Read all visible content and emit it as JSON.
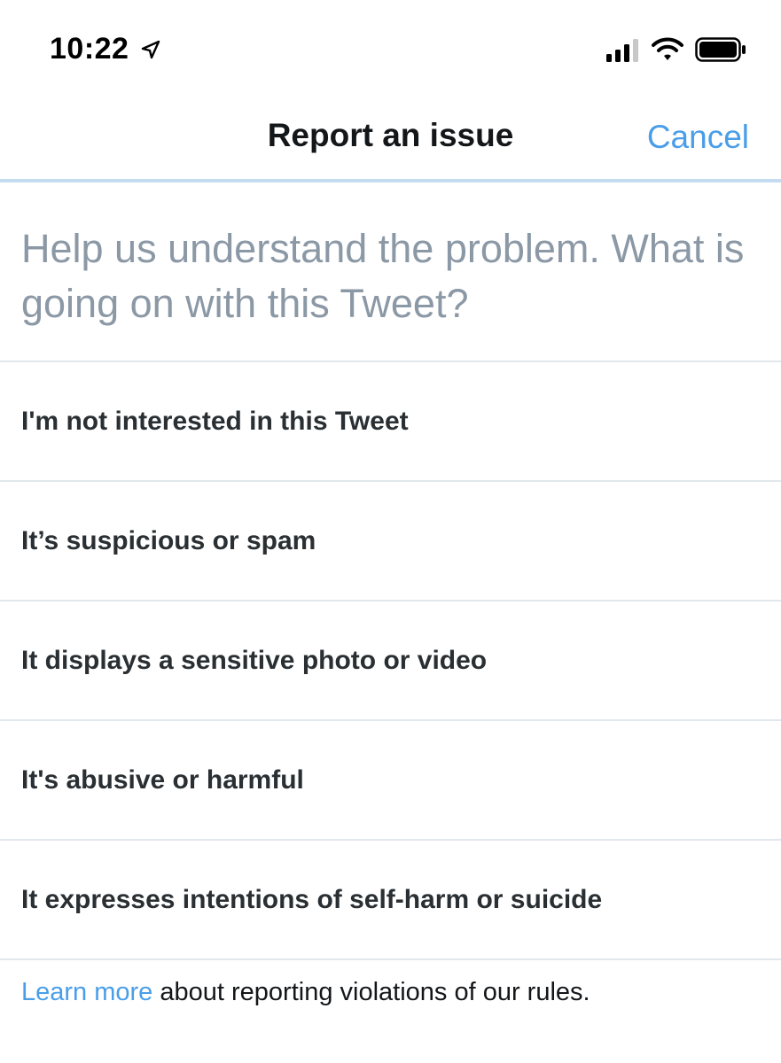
{
  "status_bar": {
    "time": "10:22",
    "icons": [
      "location-arrow-icon",
      "cellular-signal-icon",
      "wifi-icon",
      "battery-icon"
    ]
  },
  "header": {
    "title": "Report an issue",
    "cancel_label": "Cancel"
  },
  "prompt": "Help us understand the problem. What is going on with this Tweet?",
  "options": [
    "I'm not interested in this Tweet",
    "It’s suspicious or spam",
    "It displays a sensitive photo or video",
    "It's abusive or harmful",
    "It expresses intentions of self-harm or suicide"
  ],
  "footer": {
    "link_label": "Learn more",
    "text": " about reporting violations of our rules."
  },
  "colors": {
    "accent": "#4a9ee8",
    "divider": "#e1e8ed",
    "prompt_text": "#8b98a5"
  }
}
